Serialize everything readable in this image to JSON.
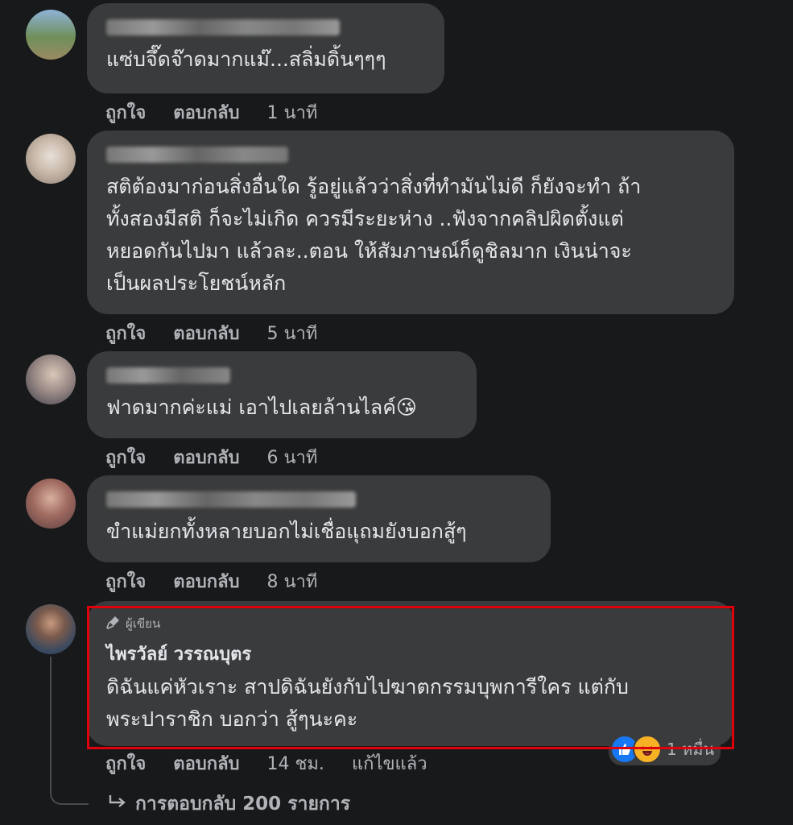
{
  "comments": [
    {
      "text": "แซ่บจึ๊ดจ๊าดมากแม๊...สลิ่มดิ้นๆๆๆ",
      "like": "ถูกใจ",
      "reply": "ตอบกลับ",
      "time": "1 นาที"
    },
    {
      "text": "สติต้องมาก่อนสิ่งอื่นใด รู้อยู่แล้วว่าสิ่งที่ทำมันไม่ดี ก็ยังจะทำ ถ้า\nทั้งสองมีสติ ก็จะไม่เกิด ควรมีระยะห่าง ..ฟังจากคลิปผิดตั้งแต่\nหยอดกันไปมา แล้วละ..ตอน ให้สัมภาษณ์ก็ดูชิลมาก เงินน่าจะ\nเป็นผลประโยชน์หลัก",
      "like": "ถูกใจ",
      "reply": "ตอบกลับ",
      "time": "5 นาที"
    },
    {
      "text": "ฟาดมากค่ะแม่ เอาไปเลยล้านไลค์😘",
      "like": "ถูกใจ",
      "reply": "ตอบกลับ",
      "time": "6 นาที"
    },
    {
      "text": "ขำแม่ยกทั้งหลายบอกไม่เชื่อแุถมยังบอกสู้ๆ",
      "like": "ถูกใจ",
      "reply": "ตอบกลับ",
      "time": "8 นาที"
    }
  ],
  "author_comment": {
    "badge": "ผู้เขียน",
    "badge_icon": "microphone-icon",
    "name": "ไพรวัลย์ วรรณบุตร",
    "text": "ดิฉันแค่หัวเราะ สาปดิฉันยังกับไปฆาตกรรมบุพการีใคร แต่กับ\nพระปาราชิก บอกว่า สู้ๆนะคะ",
    "like": "ถูกใจ",
    "reply": "ตอบกลับ",
    "time": "14 ชม.",
    "edited": "แก้ไขแล้ว",
    "reaction_count": "1 หมื่น",
    "reaction_icons": [
      "like-icon",
      "haha-icon"
    ]
  },
  "replies_link": "การตอบกลับ 200 รายการ",
  "colors": {
    "background": "#18191a",
    "bubble": "#3a3b3c",
    "highlight": "#e0000b",
    "like_blue": "#1877f2"
  }
}
